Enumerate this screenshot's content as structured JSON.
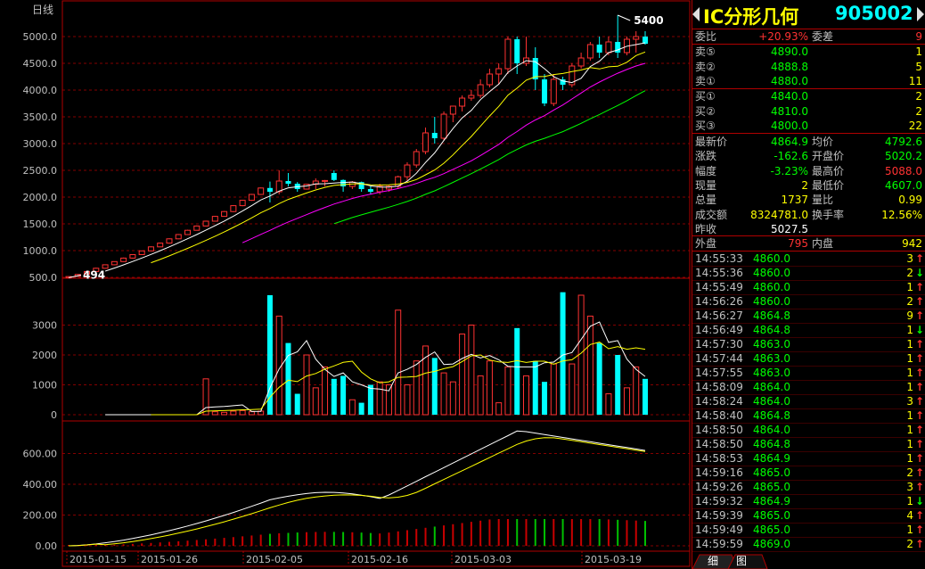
{
  "chart": {
    "period_label": "日线",
    "max_price_label": "5400",
    "min_price_label": "494",
    "price_axis": [
      "5000.0",
      "4500.0",
      "4000.0",
      "3500.0",
      "3000.0",
      "2500.0",
      "2000.0",
      "1500.0",
      "1000.0",
      "500.0"
    ],
    "volume_axis": [
      "3000",
      "2000",
      "1000",
      "0"
    ],
    "oi_axis": [
      "600.00",
      "400.00",
      "200.00",
      "0.00"
    ],
    "date_labels": [
      "2015-01-15",
      "2015-01-26",
      "2015-02-05",
      "2015-02-16",
      "2015-03-03",
      "2015-03-19"
    ]
  },
  "chart_data": {
    "type": "candlestick",
    "dates": [
      "2015-01-15",
      "2015-01-26",
      "2015-02-05",
      "2015-02-16",
      "2015-03-03",
      "2015-03-19"
    ],
    "ohlc": [
      [
        494,
        520,
        494,
        515
      ],
      [
        520,
        560,
        515,
        555
      ],
      [
        560,
        620,
        550,
        610
      ],
      [
        610,
        680,
        600,
        670
      ],
      [
        670,
        740,
        660,
        735
      ],
      [
        735,
        800,
        730,
        795
      ],
      [
        795,
        870,
        790,
        860
      ],
      [
        860,
        930,
        850,
        925
      ],
      [
        925,
        1000,
        920,
        995
      ],
      [
        995,
        1080,
        990,
        1070
      ],
      [
        1070,
        1150,
        1065,
        1140
      ],
      [
        1140,
        1230,
        1130,
        1220
      ],
      [
        1220,
        1310,
        1215,
        1300
      ],
      [
        1300,
        1390,
        1295,
        1380
      ],
      [
        1380,
        1470,
        1375,
        1460
      ],
      [
        1460,
        1560,
        1455,
        1550
      ],
      [
        1550,
        1650,
        1545,
        1640
      ],
      [
        1640,
        1740,
        1635,
        1730
      ],
      [
        1730,
        1850,
        1720,
        1840
      ],
      [
        1840,
        1950,
        1830,
        1940
      ],
      [
        1940,
        2060,
        1930,
        2050
      ],
      [
        2050,
        2180,
        2040,
        2170
      ],
      [
        2170,
        2290,
        1900,
        2100
      ],
      [
        2100,
        2500,
        2050,
        2300
      ],
      [
        2300,
        2450,
        2200,
        2250
      ],
      [
        2250,
        2280,
        2100,
        2150
      ],
      [
        2150,
        2250,
        2140,
        2240
      ],
      [
        2240,
        2350,
        2150,
        2300
      ],
      [
        2300,
        2320,
        2200,
        2310
      ],
      [
        2450,
        2500,
        2300,
        2320
      ],
      [
        2320,
        2330,
        2100,
        2200
      ],
      [
        2200,
        2300,
        2150,
        2280
      ],
      [
        2280,
        2290,
        2100,
        2150
      ],
      [
        2150,
        2200,
        2050,
        2100
      ],
      [
        2100,
        2250,
        2050,
        2200
      ],
      [
        2150,
        2220,
        2100,
        2200
      ],
      [
        2200,
        2400,
        2150,
        2380
      ],
      [
        2380,
        2650,
        2300,
        2600
      ],
      [
        2600,
        2900,
        2550,
        2850
      ],
      [
        2850,
        3300,
        2800,
        3200
      ],
      [
        3200,
        3500,
        3000,
        3100
      ],
      [
        3100,
        3600,
        3050,
        3550
      ],
      [
        3550,
        3700,
        3400,
        3700
      ],
      [
        3700,
        3900,
        3600,
        3850
      ],
      [
        3850,
        4000,
        3800,
        3900
      ],
      [
        3900,
        4200,
        3850,
        4100
      ],
      [
        4100,
        4400,
        4050,
        4300
      ],
      [
        4300,
        4500,
        4100,
        4400
      ],
      [
        4400,
        5000,
        4300,
        4950
      ],
      [
        4950,
        5000,
        4300,
        4500
      ],
      [
        4500,
        5000,
        4450,
        4600
      ],
      [
        4600,
        4800,
        4000,
        4200
      ],
      [
        4200,
        4300,
        3700,
        3750
      ],
      [
        3750,
        4300,
        3700,
        4200
      ],
      [
        4200,
        4250,
        4000,
        4100
      ],
      [
        4100,
        4500,
        4050,
        4450
      ],
      [
        4450,
        4700,
        4400,
        4600
      ],
      [
        4600,
        4900,
        4550,
        4850
      ],
      [
        4850,
        5000,
        4600,
        4700
      ],
      [
        4700,
        5000,
        4650,
        4900
      ],
      [
        4900,
        5400,
        4600,
        4700
      ],
      [
        4700,
        5000,
        4650,
        4950
      ],
      [
        4950,
        5100,
        4700,
        5000
      ],
      [
        5000,
        5100,
        4850,
        4865
      ]
    ]
  },
  "quote": {
    "name": "IC分形几何",
    "code": "905002",
    "weibi_label": "委比",
    "weibi_value": "+20.93%",
    "weicha_label": "委差",
    "weicha_value": "9",
    "asks": [
      {
        "label": "卖⑤",
        "price": "4890.0",
        "vol": "1"
      },
      {
        "label": "卖②",
        "price": "4888.8",
        "vol": "5"
      },
      {
        "label": "卖①",
        "price": "4880.0",
        "vol": "11"
      }
    ],
    "bids": [
      {
        "label": "买①",
        "price": "4840.0",
        "vol": "2"
      },
      {
        "label": "买②",
        "price": "4810.0",
        "vol": "2"
      },
      {
        "label": "买③",
        "price": "4800.0",
        "vol": "22"
      }
    ],
    "stats": [
      {
        "l1": "最新价",
        "v1": "4864.9",
        "c1": "green",
        "l2": "均价",
        "v2": "4792.6",
        "c2": "green"
      },
      {
        "l1": "涨跌",
        "v1": "-162.6",
        "c1": "green",
        "l2": "开盘价",
        "v2": "5020.2",
        "c2": "green"
      },
      {
        "l1": "幅度",
        "v1": "-3.23%",
        "c1": "green",
        "l2": "最高价",
        "v2": "5088.0",
        "c2": "red"
      },
      {
        "l1": "现量",
        "v1": "2",
        "c1": "yellow",
        "l2": "最低价",
        "v2": "4607.0",
        "c2": "green"
      },
      {
        "l1": "总量",
        "v1": "1737",
        "c1": "yellow",
        "l2": "量比",
        "v2": "0.99",
        "c2": "yellow"
      },
      {
        "l1": "成交额",
        "v1": "8324781.0",
        "c1": "yellow",
        "l2": "换手率",
        "v2": "12.56%",
        "c2": "yellow"
      },
      {
        "l1": "昨收",
        "v1": "5027.5",
        "c1": "white",
        "l2": "",
        "v2": "",
        "c2": "white"
      }
    ],
    "waipan_label": "外盘",
    "waipan_value": "795",
    "neipan_label": "内盘",
    "neipan_value": "942",
    "ticks": [
      {
        "time": "14:55:33",
        "price": "4860.0",
        "vol": "3",
        "dir": "↑",
        "dc": "red"
      },
      {
        "time": "14:55:36",
        "price": "4860.0",
        "vol": "2",
        "dir": "↓",
        "dc": "green"
      },
      {
        "time": "14:55:49",
        "price": "4860.0",
        "vol": "1",
        "dir": "↑",
        "dc": "red"
      },
      {
        "time": "14:56:26",
        "price": "4860.0",
        "vol": "2",
        "dir": "↑",
        "dc": "red"
      },
      {
        "time": "14:56:27",
        "price": "4864.8",
        "vol": "9",
        "dir": "↑",
        "dc": "red"
      },
      {
        "time": "14:56:49",
        "price": "4864.8",
        "vol": "1",
        "dir": "↓",
        "dc": "green"
      },
      {
        "time": "14:57:30",
        "price": "4863.0",
        "vol": "1",
        "dir": "↑",
        "dc": "red"
      },
      {
        "time": "14:57:44",
        "price": "4863.0",
        "vol": "1",
        "dir": "↑",
        "dc": "red"
      },
      {
        "time": "14:57:55",
        "price": "4863.0",
        "vol": "1",
        "dir": "↑",
        "dc": "red"
      },
      {
        "time": "14:58:09",
        "price": "4864.0",
        "vol": "1",
        "dir": "↑",
        "dc": "red"
      },
      {
        "time": "14:58:24",
        "price": "4864.0",
        "vol": "3",
        "dir": "↑",
        "dc": "red"
      },
      {
        "time": "14:58:40",
        "price": "4864.8",
        "vol": "1",
        "dir": "↑",
        "dc": "red"
      },
      {
        "time": "14:58:50",
        "price": "4864.0",
        "vol": "1",
        "dir": "↑",
        "dc": "red"
      },
      {
        "time": "14:58:50",
        "price": "4864.8",
        "vol": "1",
        "dir": "↑",
        "dc": "red"
      },
      {
        "time": "14:58:53",
        "price": "4864.9",
        "vol": "1",
        "dir": "↑",
        "dc": "red"
      },
      {
        "time": "14:59:16",
        "price": "4865.0",
        "vol": "2",
        "dir": "↑",
        "dc": "red"
      },
      {
        "time": "14:59:26",
        "price": "4865.0",
        "vol": "3",
        "dir": "↑",
        "dc": "red"
      },
      {
        "time": "14:59:32",
        "price": "4864.9",
        "vol": "1",
        "dir": "↓",
        "dc": "green"
      },
      {
        "time": "14:59:39",
        "price": "4865.0",
        "vol": "4",
        "dir": "↑",
        "dc": "red"
      },
      {
        "time": "14:59:49",
        "price": "4865.0",
        "vol": "1",
        "dir": "↑",
        "dc": "red"
      },
      {
        "time": "14:59:59",
        "price": "4869.0",
        "vol": "2",
        "dir": "↑",
        "dc": "red"
      }
    ],
    "tabs": [
      "细",
      "图"
    ]
  },
  "colors": {
    "up": "#ff3232",
    "down": "#00ffff",
    "grid": "#b00000",
    "ma1": "#ffffff",
    "ma2": "#ffff00",
    "ma3": "#ff00ff",
    "ma4": "#00ff00"
  }
}
